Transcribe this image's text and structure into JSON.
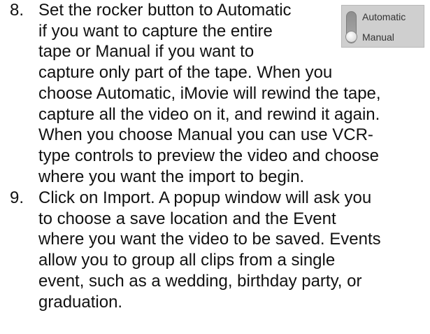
{
  "steps": [
    {
      "number": "8.",
      "lines": [
        "Set the rocker button to Automatic",
        "if you want to capture the entire",
        "tape or Manual if you want to",
        "capture only part of the tape. When you",
        "choose Automatic, iMovie will rewind the tape,",
        "capture all the video on it, and rewind it again.",
        "When you choose Manual you can use VCR-",
        "type controls to preview the video and choose",
        "where you want the import to begin."
      ]
    },
    {
      "number": "9.",
      "lines": [
        "Click on Import. A popup window will ask you",
        "to choose a save location and the Event",
        "where you want the video to be saved. Events",
        "allow you to group all clips from a single",
        "event, such as a wedding, birthday party, or",
        "graduation."
      ]
    }
  ],
  "rocker": {
    "top_label": "Automatic",
    "bottom_label": "Manual",
    "selected": "Manual"
  }
}
